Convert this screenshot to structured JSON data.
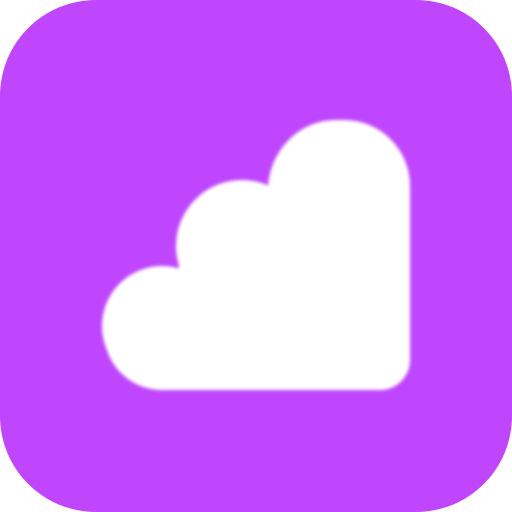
{
  "icon": {
    "name": "cloud-app-icon",
    "glyph": "cloud-icon",
    "background_color": "#BF46FD",
    "glyph_color": "#FFFFFF",
    "page_background": "#FFFFFF"
  }
}
